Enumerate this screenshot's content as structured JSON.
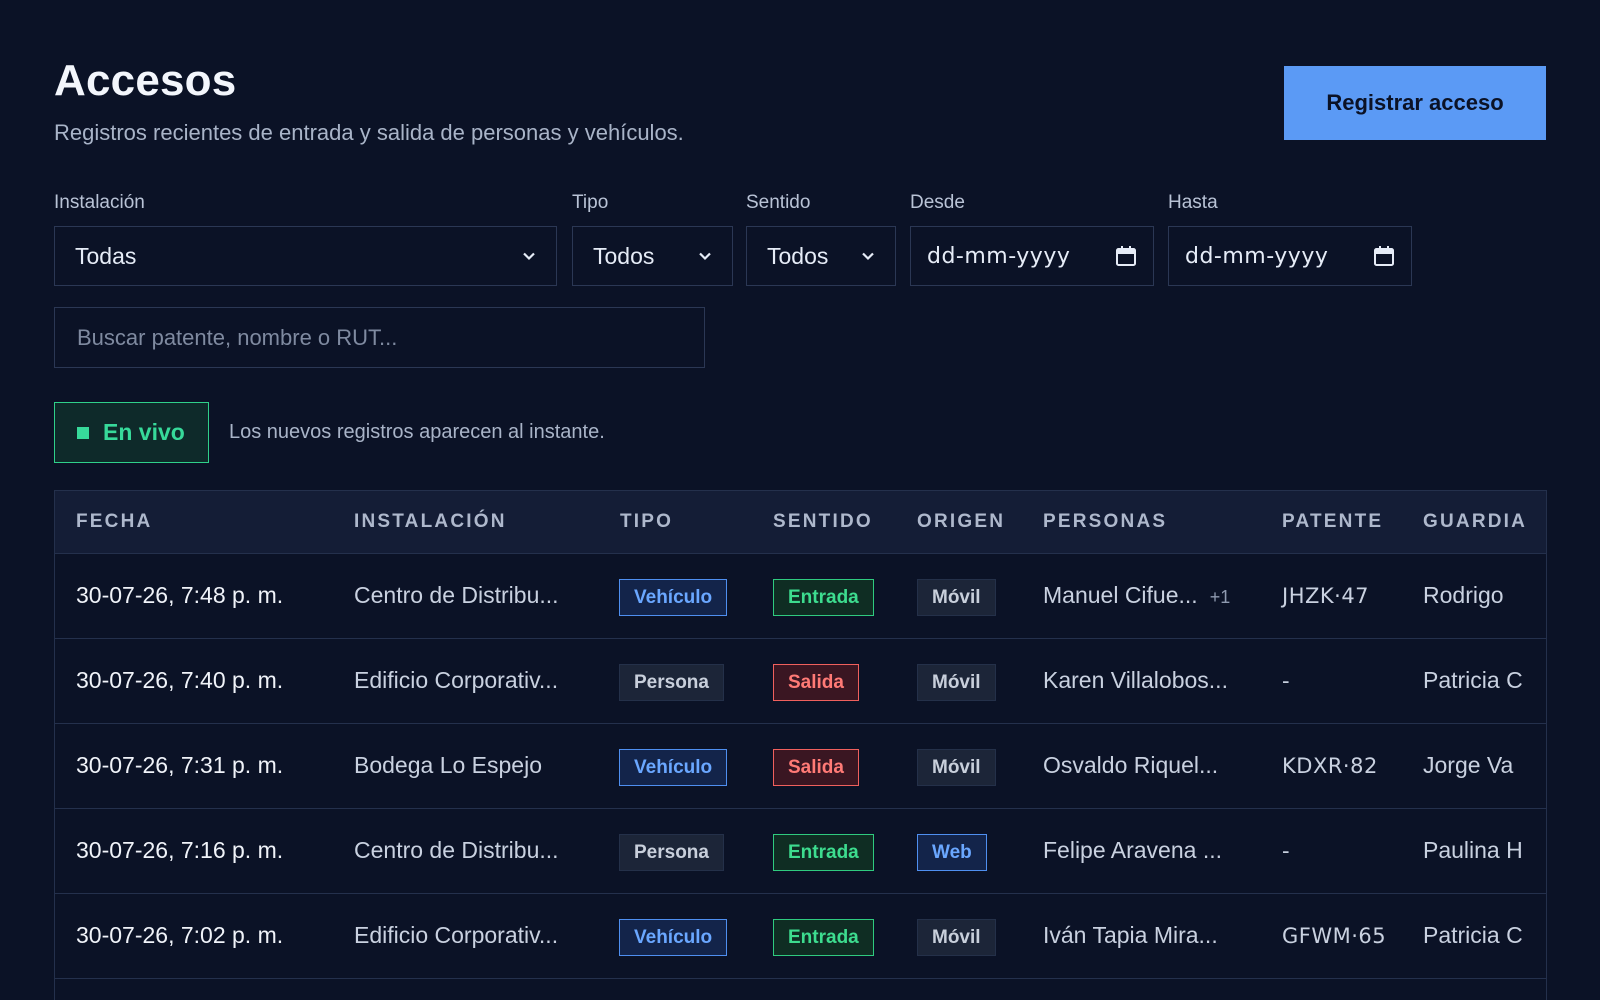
{
  "header": {
    "title": "Accesos",
    "subtitle": "Registros recientes de entrada y salida de personas y vehículos.",
    "primary_button": "Registrar acceso"
  },
  "filters": {
    "instalacion": {
      "label": "Instalación",
      "value": "Todas"
    },
    "tipo": {
      "label": "Tipo",
      "value": "Todos"
    },
    "sentido": {
      "label": "Sentido",
      "value": "Todos"
    },
    "desde": {
      "label": "Desde",
      "value": "dd-mm-yyyy"
    },
    "hasta": {
      "label": "Hasta",
      "value": "dd-mm-yyyy"
    },
    "search_placeholder": "Buscar patente, nombre o RUT..."
  },
  "live": {
    "badge": "En vivo",
    "note": "Los nuevos registros aparecen al instante."
  },
  "table": {
    "columns": [
      "FECHA",
      "INSTALACIÓN",
      "TIPO",
      "SENTIDO",
      "ORIGEN",
      "PERSONAS",
      "PATENTE",
      "GUARDIA"
    ],
    "rows": [
      {
        "fecha": "30-07-26, 7:48 p. m.",
        "instalacion": "Centro de Distribu...",
        "tipo": "Vehículo",
        "sentido": "Entrada",
        "origen": "Móvil",
        "personas": "Manuel Cifue...",
        "extra": "+1",
        "patente": "JHZK·47",
        "guardia": "Rodrigo"
      },
      {
        "fecha": "30-07-26, 7:40 p. m.",
        "instalacion": "Edificio Corporativ...",
        "tipo": "Persona",
        "sentido": "Salida",
        "origen": "Móvil",
        "personas": "Karen Villalobos...",
        "extra": "",
        "patente": "-",
        "guardia": "Patricia C"
      },
      {
        "fecha": "30-07-26, 7:31 p. m.",
        "instalacion": "Bodega Lo Espejo",
        "tipo": "Vehículo",
        "sentido": "Salida",
        "origen": "Móvil",
        "personas": "Osvaldo Riquel...",
        "extra": "",
        "patente": "KDXR·82",
        "guardia": "Jorge Va"
      },
      {
        "fecha": "30-07-26, 7:16 p. m.",
        "instalacion": "Centro de Distribu...",
        "tipo": "Persona",
        "sentido": "Entrada",
        "origen": "Web",
        "personas": "Felipe Aravena ...",
        "extra": "",
        "patente": "-",
        "guardia": "Paulina H"
      },
      {
        "fecha": "30-07-26, 7:02 p. m.",
        "instalacion": "Edificio Corporativ...",
        "tipo": "Vehículo",
        "sentido": "Entrada",
        "origen": "Móvil",
        "personas": "Iván Tapia Mira...",
        "extra": "",
        "patente": "GFWM·65",
        "guardia": "Patricia C"
      }
    ]
  },
  "colors": {
    "background": "#0b1226",
    "accent": "#5b9af5",
    "entrada": "#3ddc8f",
    "salida": "#ff7a76",
    "live": "#37d99a"
  },
  "icons": {
    "select": "chevron-down-icon",
    "date": "calendar-icon",
    "live": "live-dot-icon"
  }
}
